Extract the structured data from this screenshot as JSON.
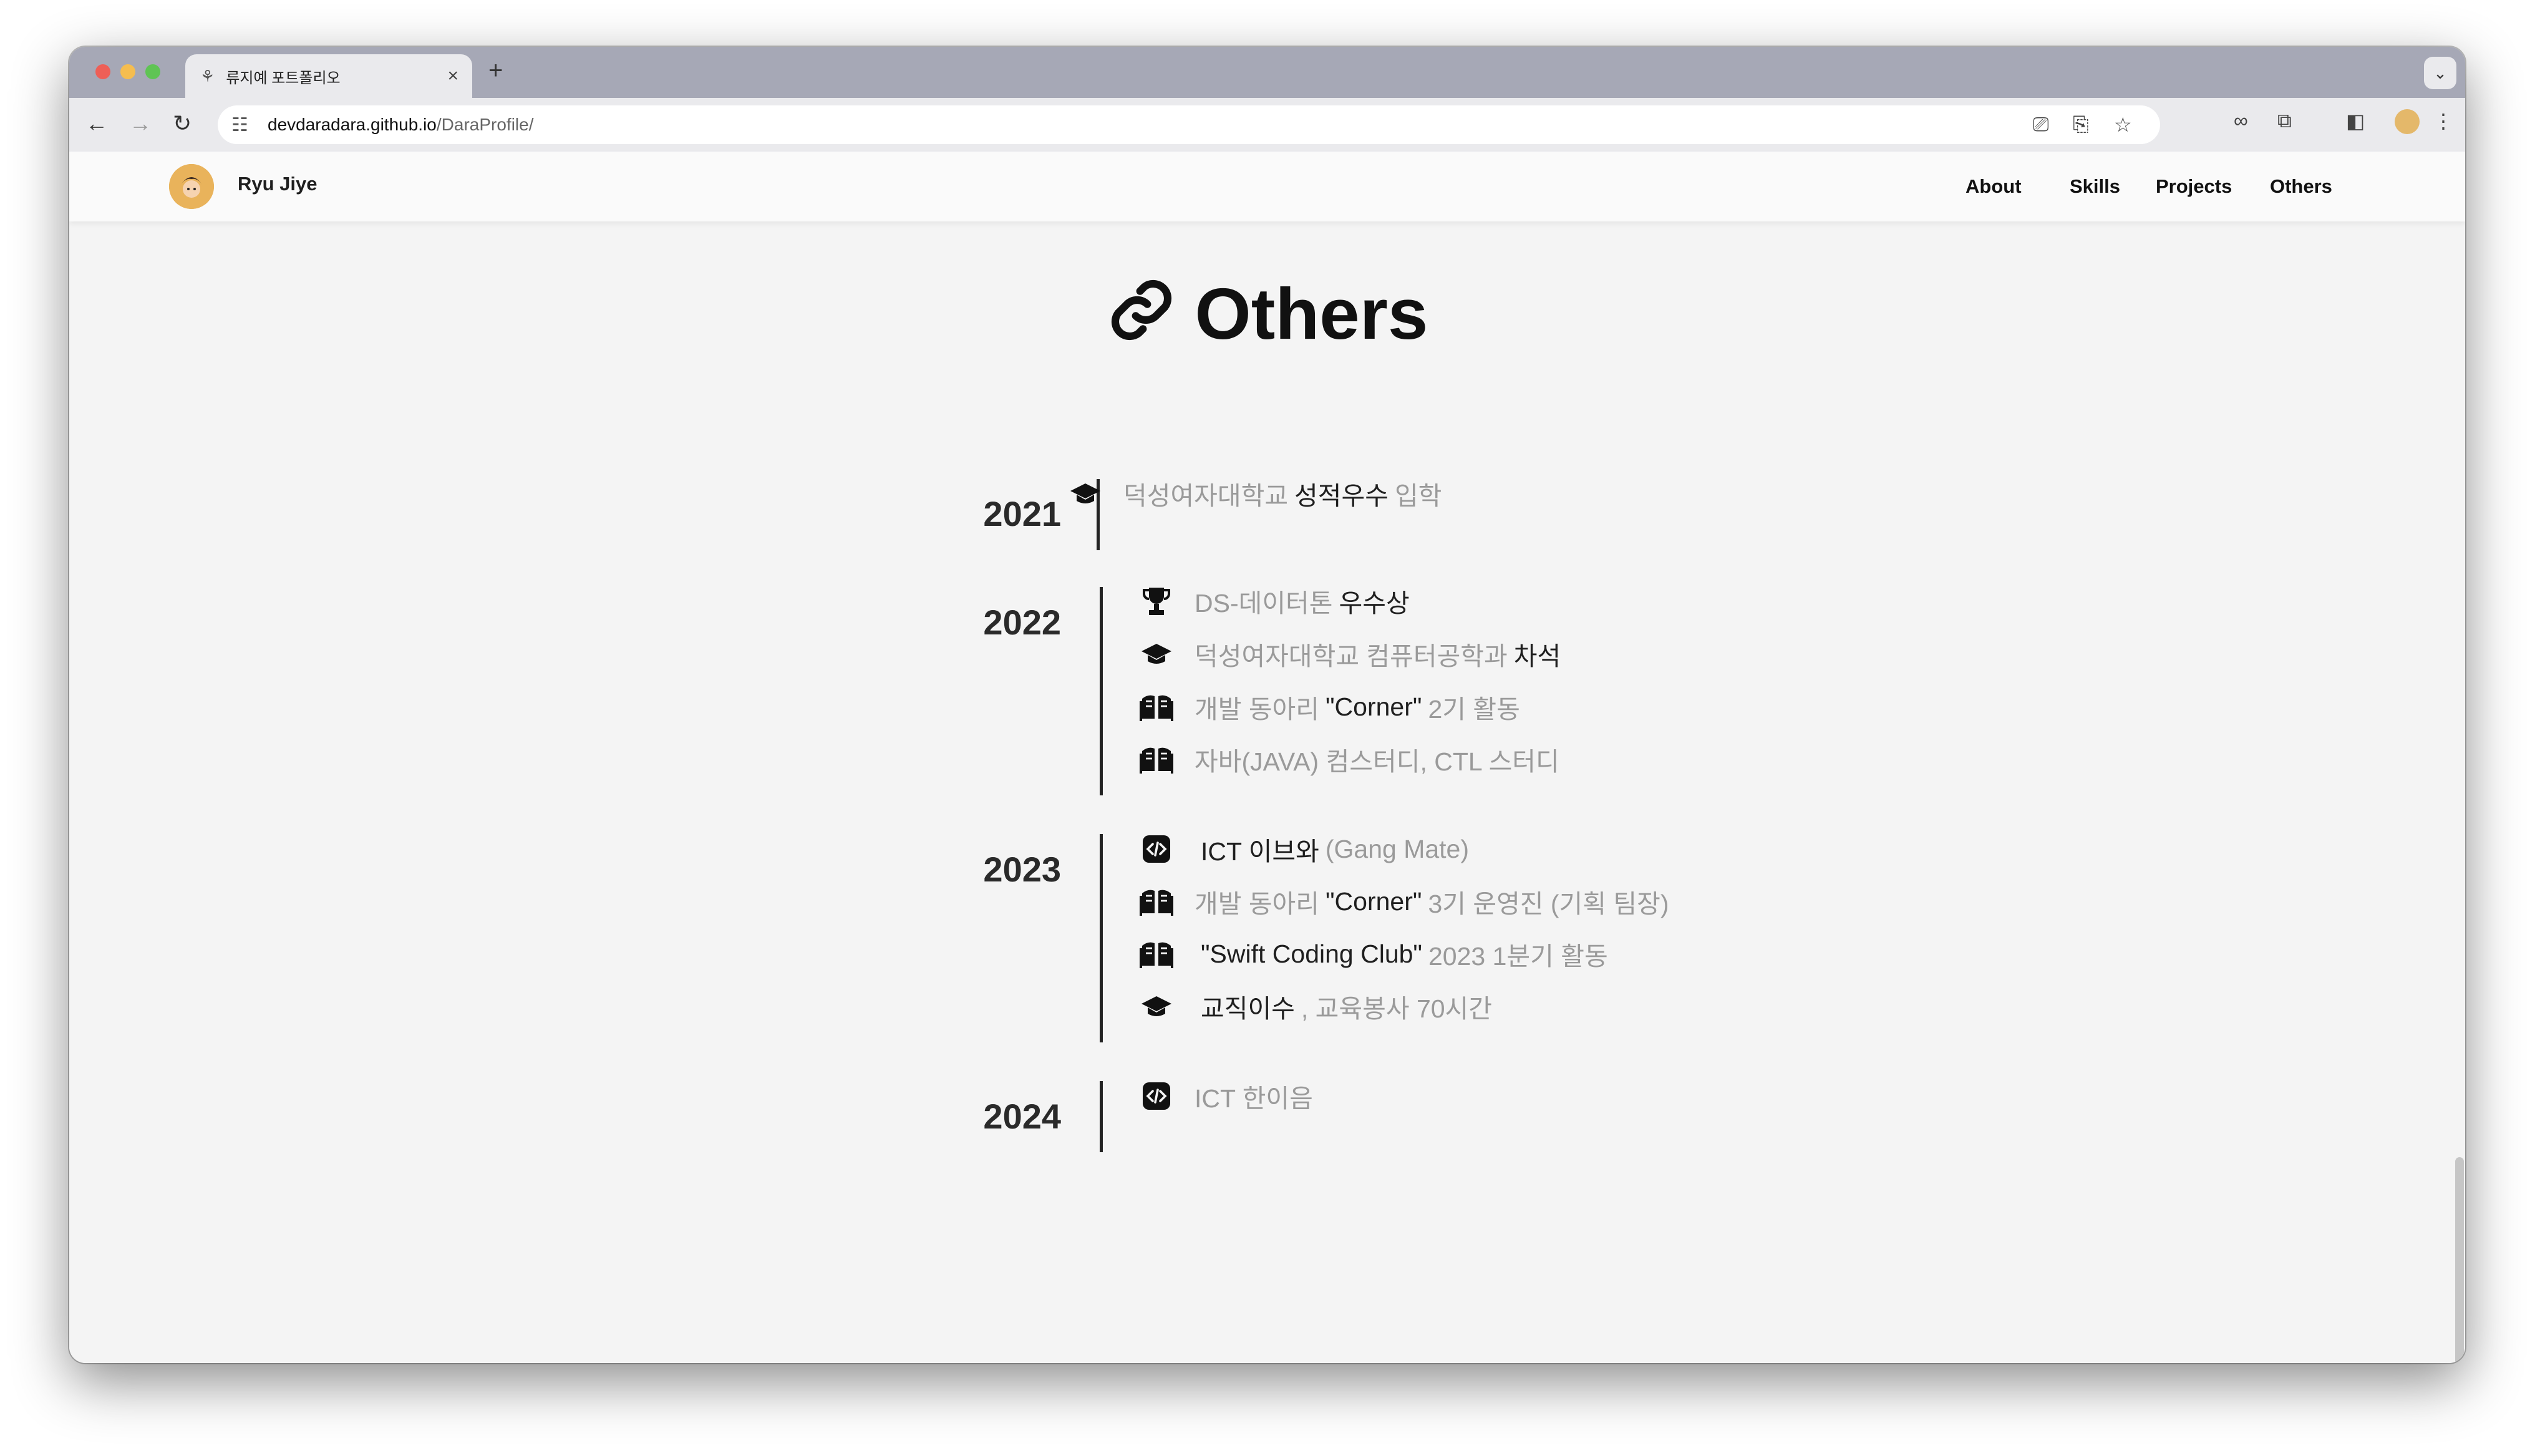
{
  "browser": {
    "tab_title": "류지예 포트폴리오",
    "url_host": "devdaradara.github.io",
    "url_path": "/DaraProfile/"
  },
  "header": {
    "name": "Ryu Jiye",
    "nav": [
      "About",
      "Skills",
      "Projects",
      "Others"
    ]
  },
  "section": {
    "title": "Others"
  },
  "timeline": [
    {
      "year": "2021",
      "items": [
        {
          "icon": "graduation-cap-icon",
          "pre": "덕성여자대학교",
          "strong": "성적우수",
          "post": "입학"
        }
      ]
    },
    {
      "year": "2022",
      "items": [
        {
          "icon": "trophy-icon",
          "pre": "DS-데이터톤",
          "strong": "우수상",
          "post": ""
        },
        {
          "icon": "graduation-cap-icon",
          "pre": "덕성여자대학교 컴퓨터공학과",
          "strong": "차석",
          "post": ""
        },
        {
          "icon": "book-icon",
          "pre": "개발 동아리",
          "strong": "\"Corner\"",
          "post": "2기 활동"
        },
        {
          "icon": "book-icon",
          "pre": "자바(JAVA) 컴스터디, CTL 스터디",
          "strong": "",
          "post": ""
        }
      ]
    },
    {
      "year": "2023",
      "items": [
        {
          "icon": "code-icon",
          "pre": "",
          "strong": "ICT 이브와",
          "post": "(Gang Mate)"
        },
        {
          "icon": "book-icon",
          "pre": "개발 동아리",
          "strong": "\"Corner\"",
          "post": "3기 운영진 (기획 팀장)"
        },
        {
          "icon": "book-icon",
          "pre": "",
          "strong": "\"Swift Coding Club\"",
          "post": "2023 1분기 활동"
        },
        {
          "icon": "graduation-cap-icon",
          "pre": "",
          "strong": "교직이수",
          "post": ", 교육봉사 70시간"
        }
      ]
    },
    {
      "year": "2024",
      "items": [
        {
          "icon": "code-icon",
          "pre": "ICT 한이음",
          "strong": "",
          "post": ""
        }
      ]
    }
  ]
}
